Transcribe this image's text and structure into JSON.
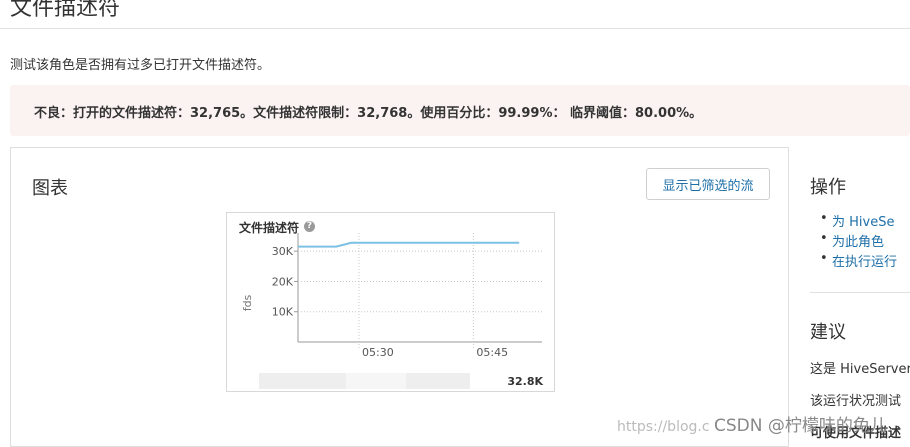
{
  "page": {
    "title": "文件描述符",
    "description": "测试该角色是否拥有过多已打开文件描述符。"
  },
  "alert": {
    "text": "不良：打开的文件描述符：32,765。文件描述符限制：32,768。使用百分比：99.99%： 临界阈值：80.00%。"
  },
  "panel": {
    "title": "图表",
    "filter_button": "显示已筛选的流"
  },
  "chart": {
    "title": "文件描述符",
    "help": "?",
    "y_unit": "fds",
    "legend_value": "32.8K"
  },
  "chart_data": {
    "type": "line",
    "title": "文件描述符",
    "ylabel": "fds",
    "xlabel": "",
    "x_ticks": [
      "05:30",
      "05:45"
    ],
    "y_ticks": [
      "10K",
      "20K",
      "30K"
    ],
    "ylim": [
      0,
      36000
    ],
    "series": [
      {
        "color": "#7cc1e4",
        "points": [
          {
            "t": "05:22",
            "v": 31500
          },
          {
            "t": "05:27",
            "v": 31500
          },
          {
            "t": "05:29",
            "v": 32765
          },
          {
            "t": "05:35",
            "v": 32765
          },
          {
            "t": "05:45",
            "v": 32765
          },
          {
            "t": "05:51",
            "v": 32765
          }
        ]
      }
    ],
    "grid": true
  },
  "sidebar": {
    "actions_heading": "操作",
    "actions": [
      "为 HiveSe",
      "为此角色",
      "在执行运行"
    ],
    "advice_heading": "建议",
    "advice_lines": [
      "这是 HiveServer",
      "该运行状况测试",
      "可使用文件描述"
    ]
  },
  "watermark": {
    "url": "https://blog.c",
    "brand": "CSDN @柠檬味的兔儿"
  },
  "colors": {
    "link": "#1e6fa8",
    "alert_bg": "#fbf3f2",
    "series": "#7cc1e4"
  }
}
